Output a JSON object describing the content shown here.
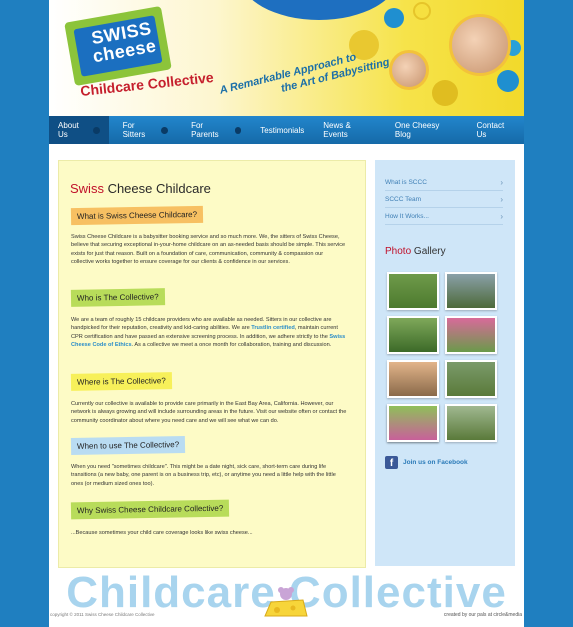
{
  "header": {
    "logo_line1": "SWISS",
    "logo_line2": "cheese",
    "logo_sub": "Childcare Collective",
    "tagline_line1": "A Remarkable Approach to",
    "tagline_line2": "the Art of Babysitting"
  },
  "nav": {
    "items": [
      {
        "label": "About Us",
        "active": true,
        "dropdown": true
      },
      {
        "label": "For Sitters",
        "dropdown": true
      },
      {
        "label": "For Parents",
        "dropdown": true
      },
      {
        "label": "Testimonials"
      },
      {
        "label": "News & Events"
      },
      {
        "label": "One Cheesy Blog"
      },
      {
        "label": "Contact Us"
      }
    ]
  },
  "main": {
    "title_red": "Swiss",
    "title_rest": " Cheese Childcare",
    "sections": [
      {
        "heading": "What is Swiss Cheese Childcare?",
        "text": "Swiss Cheese Childcare is a babysitter booking service and so much more.  We, the sitters of Swiss Cheese, believe that securing exceptional in-your-home childcare on an as-needed basis should be simple. This service exists for just that reason. Built on a foundation of care, communication, community & compassion our collective works together to ensure coverage for our clients & confidence in our services."
      },
      {
        "heading": "Who is The Collective?",
        "text_a": "We are a team of roughly 15 childcare providers who are available as needed.   Sitters in our collective are handpicked for their reputation, creativity and kid-caring abilities. We are ",
        "link1": "Trustlin certified",
        "text_b": ", maintain current CPR certification and have passed an extensive screening process. In addition, we adhere strictly to the ",
        "link2": "Swiss Cheese Code of Ethics",
        "text_c": ". As a collective we meet a once month for collaboration, training and discussion."
      },
      {
        "heading": "Where is The Collective?",
        "text": "Currently our collective is available to provide care primarily in the East Bay Area, California. However, our network is always growing and will include surrounding areas in the future. Visit our website often or contact the community coordinator about where you need care and we will see what we can do."
      },
      {
        "heading": "When to use The Collective?",
        "text": "When you need \"sometimes childcare\". This might be a date night, sick care, short-term care during life transitions (a new baby, one parent is on a business trip, etc), or anytime you need a little help with the little ones (or medium sized ones too)."
      },
      {
        "heading": "Why Swiss Cheese Childcare Collective?",
        "text": "...Because sometimes your child care coverage looks like swiss cheese..."
      }
    ]
  },
  "sidebar": {
    "links": [
      "What is SCCC",
      "SCCC Team",
      "How It Works..."
    ],
    "gallery_red": "Photo",
    "gallery_rest": " Gallery",
    "facebook": "Join us on Facebook"
  },
  "footer": {
    "big_text": "Childcare Collective",
    "copyright": "copyright © 2011 Swiss Cheese Childcare Collective",
    "credit": "created by our pals at circle&media"
  },
  "colors": {
    "nav_blue": "#1b78bd",
    "brand_red": "#c0112a",
    "highlight_orange": "#f7c062",
    "highlight_green": "#b8dc5a",
    "highlight_yellow": "#f7f05a",
    "highlight_blue": "#b9dcf2"
  }
}
